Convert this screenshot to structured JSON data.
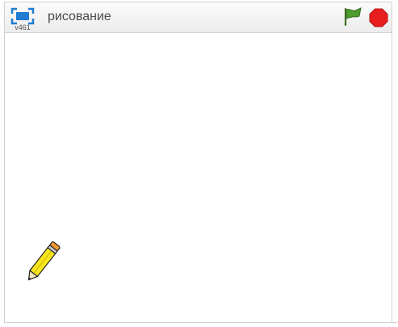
{
  "player": {
    "version": "v461",
    "title": "рисование"
  },
  "controls": {
    "fullscreen_icon": "fullscreen-icon",
    "flag_icon": "green-flag-icon",
    "stop_icon": "stop-icon"
  },
  "stage": {
    "sprite_icon": "pencil-sprite"
  },
  "colors": {
    "accent_blue": "#1f7ad1",
    "flag_green": "#4c9c2e",
    "stop_red": "#e81e1e",
    "pencil_yellow": "#f7e51e",
    "pencil_eraser": "#f29a2e"
  }
}
